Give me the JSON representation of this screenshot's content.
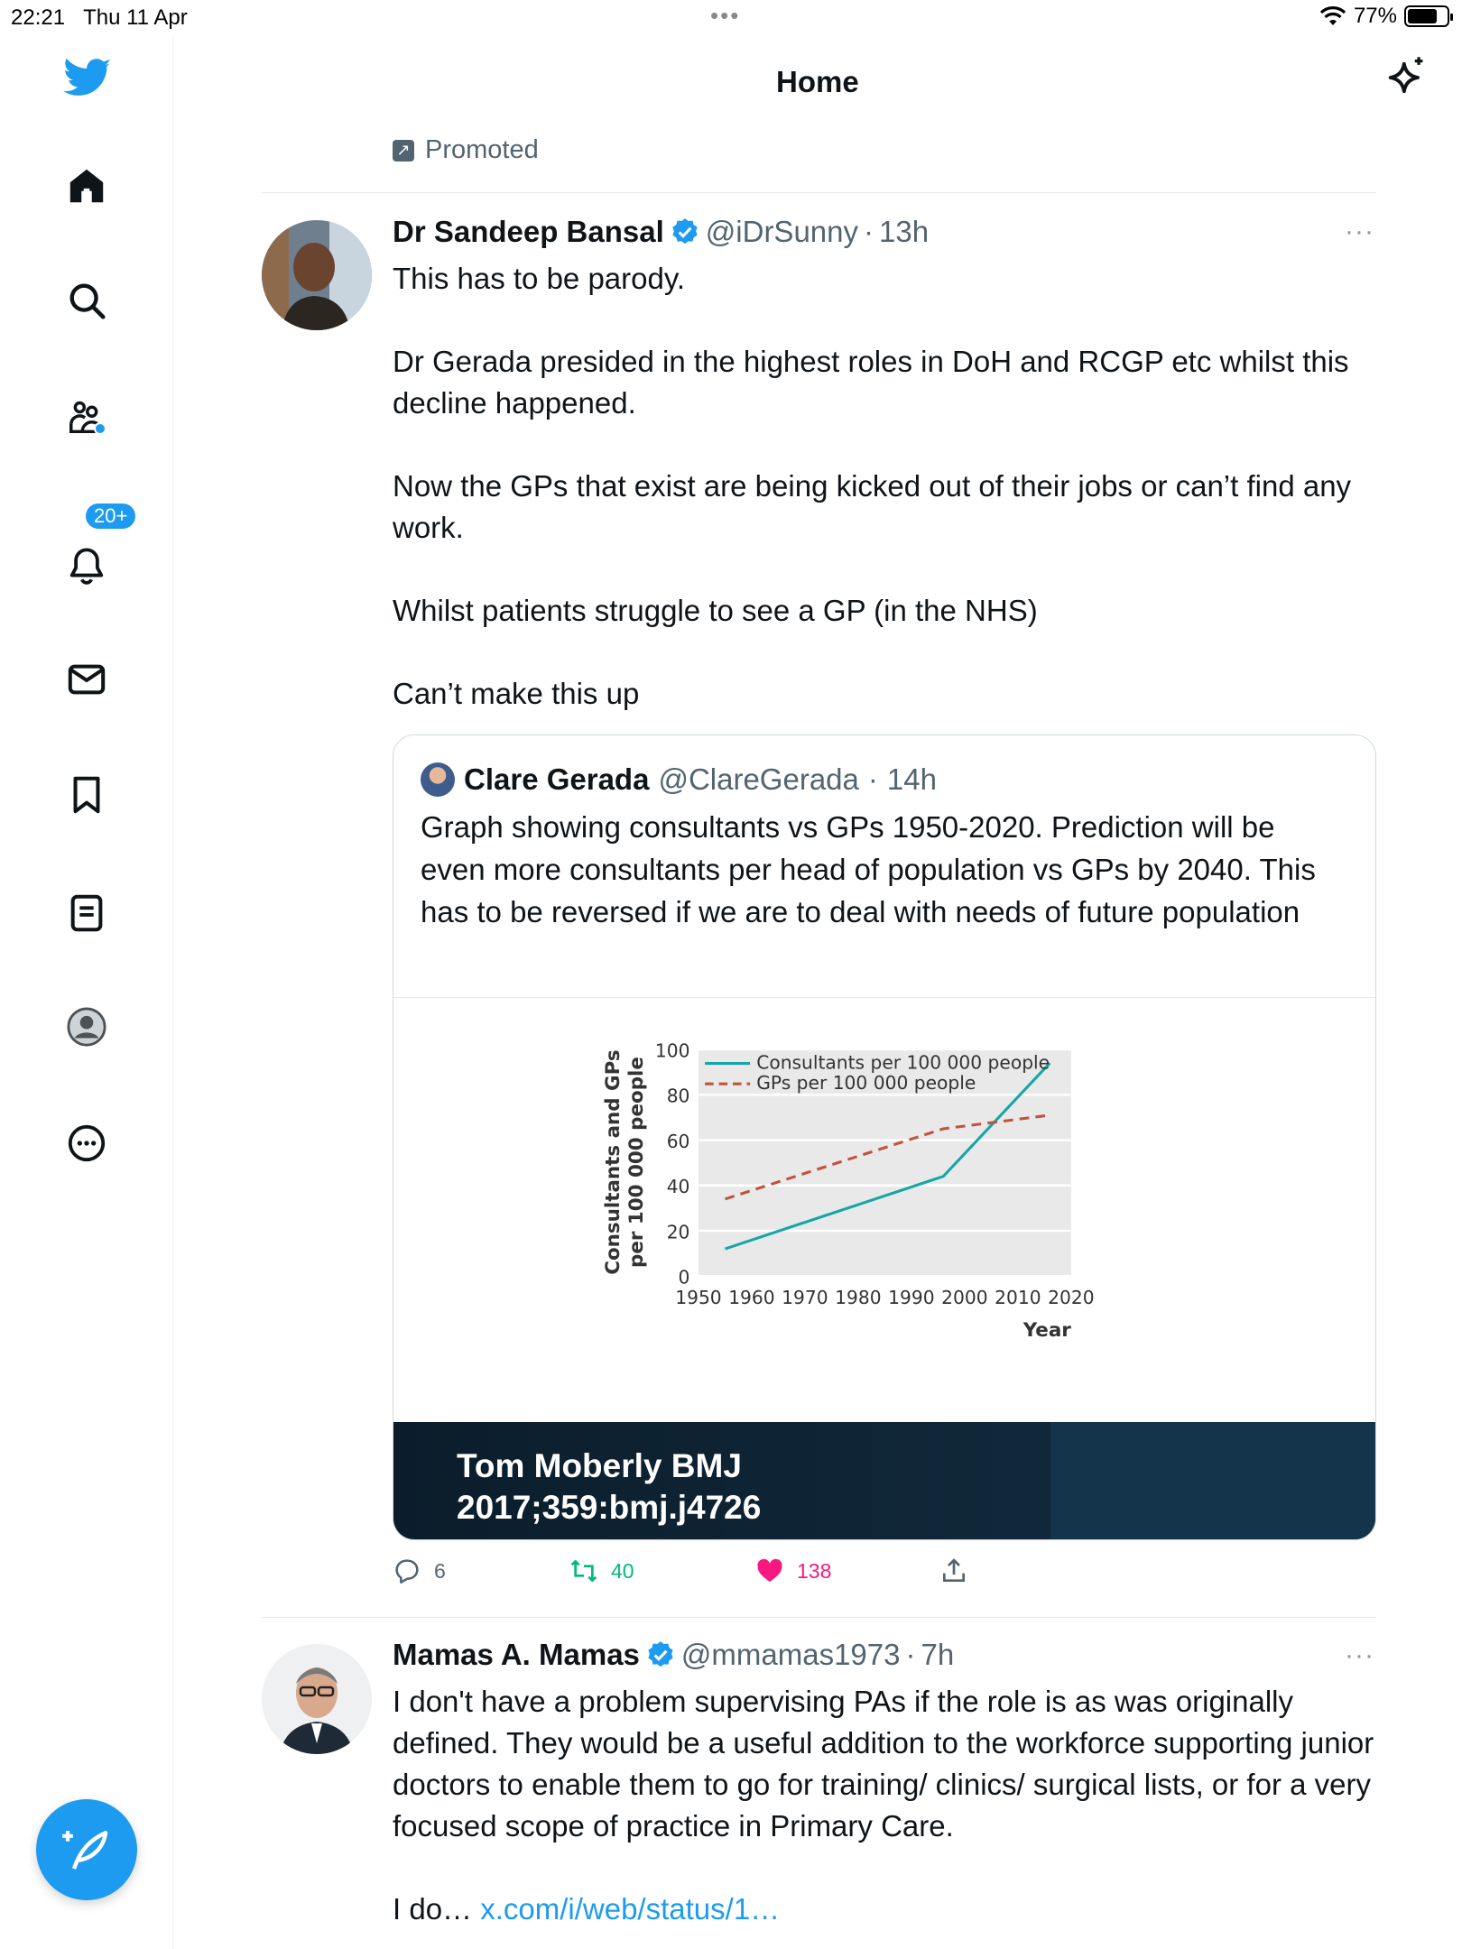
{
  "status_bar": {
    "time": "22:21",
    "date": "Thu 11 Apr",
    "battery_text": "77%",
    "battery_level": 0.77
  },
  "header": {
    "title": "Home"
  },
  "sidebar": {
    "items": [
      {
        "name": "home-icon"
      },
      {
        "name": "search-icon"
      },
      {
        "name": "communities-icon"
      },
      {
        "name": "notifications-icon",
        "badge": "20+"
      },
      {
        "name": "messages-icon"
      },
      {
        "name": "bookmarks-icon"
      },
      {
        "name": "lists-icon"
      },
      {
        "name": "profile-icon"
      },
      {
        "name": "more-icon"
      }
    ],
    "compose_icon": "compose-icon"
  },
  "promoted_label": "Promoted",
  "tweet1": {
    "name": "Dr Sandeep Bansal",
    "handle": "@iDrSunny",
    "time": "13h",
    "paragraphs": [
      "This has to be parody.",
      "Dr Gerada presided in the highest roles in DoH and RCGP etc whilst this decline happened.",
      "Now the GPs that exist are being kicked out of their jobs or can’t find any work.",
      "Whilst patients struggle to see a GP (in the NHS)",
      "Can’t make this up"
    ],
    "quote": {
      "name": "Clare Gerada",
      "handle": "@ClareGerada",
      "time": "14h",
      "text": "Graph showing consultants vs GPs 1950-2020. Prediction will be even more consultants per head of population vs GPs by 2040. This has to be reversed if we are to deal with needs of future population",
      "caption_line1": "Tom Moberly BMJ",
      "caption_line2": "2017;359:bmj.j4726"
    },
    "actions": {
      "replies": "6",
      "retweets": "40",
      "likes": "138"
    }
  },
  "tweet2": {
    "name": "Mamas A. Mamas",
    "handle": "@mmamas1973",
    "time": "7h",
    "paragraphs": [
      "I don't have a problem supervising PAs if the role is as was originally defined. They would be a useful addition to the workforce supporting junior doctors to enable them to go for training/ clinics/ surgical lists, or for a very focused scope of practice in Primary Care."
    ],
    "truncated_prefix": "I do… ",
    "truncated_link": "x.com/i/web/status/1…"
  },
  "chart_data": {
    "type": "line",
    "ylabel_line1": "Consultants and GPs",
    "ylabel_line2": "per 100 000 people",
    "xlabel": "Year",
    "ylim": [
      0,
      100
    ],
    "xlim": [
      1950,
      2020
    ],
    "x_ticks": [
      "1950",
      "1960",
      "1970",
      "1980",
      "1990",
      "2000",
      "2010",
      "2020"
    ],
    "y_ticks": [
      "0",
      "20",
      "40",
      "60",
      "80",
      "100"
    ],
    "grid": true,
    "legend_position": "top-left",
    "series": [
      {
        "name": "Consultants per 100 000 people",
        "color": "#17a6a6",
        "dash": false,
        "x": [
          1955,
          1996,
          2016
        ],
        "y": [
          12,
          44,
          94
        ]
      },
      {
        "name": "GPs per 100 000 people",
        "color": "#c0533d",
        "dash": true,
        "x": [
          1955,
          1996,
          2016
        ],
        "y": [
          34,
          65,
          71
        ]
      }
    ]
  }
}
